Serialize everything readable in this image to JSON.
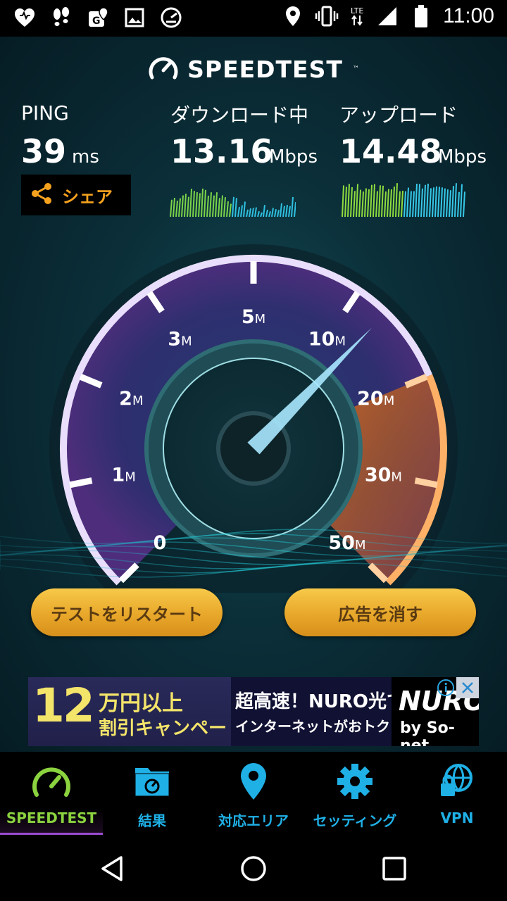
{
  "status_bar": {
    "network_type": "LTE",
    "time": "11:00",
    "icons": [
      "heart-icon",
      "footprints-icon",
      "maps-icon",
      "photo-icon",
      "speedometer-icon",
      "location-icon",
      "vibrate-icon",
      "signal-icon",
      "battery-icon"
    ]
  },
  "app": {
    "title": "SPEEDTEST",
    "ping": {
      "label": "PING",
      "value": "39",
      "unit": "ms"
    },
    "download": {
      "label": "ダウンロード中",
      "value": "13.16",
      "unit": "Mbps"
    },
    "upload": {
      "label": "アップロード",
      "value": "14.48",
      "unit": "Mbps"
    },
    "share_label": "シェア",
    "gauge": {
      "ticks": [
        {
          "v": "0",
          "u": ""
        },
        {
          "v": "1",
          "u": "M"
        },
        {
          "v": "2",
          "u": "M"
        },
        {
          "v": "3",
          "u": "M"
        },
        {
          "v": "5",
          "u": "M"
        },
        {
          "v": "10",
          "u": "M"
        },
        {
          "v": "20",
          "u": "M"
        },
        {
          "v": "30",
          "u": "M"
        },
        {
          "v": "50",
          "u": "M"
        }
      ],
      "needle_value_mbps": 13.16
    },
    "restart_button": "テストをリスタート",
    "remove_ads_button": "広告を消す",
    "ad": {
      "big_number": "12",
      "line1": "万円以上",
      "line2": "割引キャンペーン",
      "line3": "超高速！NURO光で",
      "line4": "インターネットがおトク！",
      "brand": "NURO",
      "brand_sub": "by So-net"
    }
  },
  "bottom_nav": [
    {
      "label": "SPEEDTEST",
      "icon": "speedometer-icon",
      "active": true
    },
    {
      "label": "結果",
      "icon": "results-folder-icon",
      "active": false
    },
    {
      "label": "対応エリア",
      "icon": "map-pin-icon",
      "active": false
    },
    {
      "label": "セッティング",
      "icon": "gear-icon",
      "active": false
    },
    {
      "label": "VPN",
      "icon": "vpn-lock-icon",
      "active": false
    }
  ],
  "system_nav": [
    "back-icon",
    "home-icon",
    "recents-icon"
  ],
  "colors": {
    "accent_orange": "#f6a21e",
    "nav_blue": "#1fb0e6",
    "active_green": "#8bd23f",
    "button_gold": "#e8a72a"
  }
}
